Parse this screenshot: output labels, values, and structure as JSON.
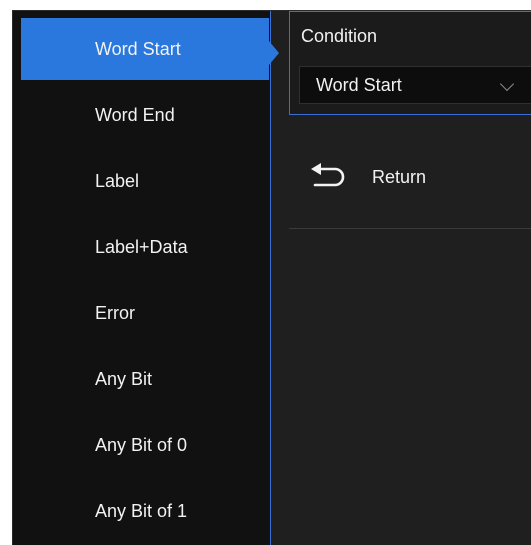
{
  "trigger_condition_list": {
    "items": [
      {
        "label": "Word Start",
        "selected": true
      },
      {
        "label": "Word End",
        "selected": false
      },
      {
        "label": "Label",
        "selected": false
      },
      {
        "label": "Label+Data",
        "selected": false
      },
      {
        "label": "Error",
        "selected": false
      },
      {
        "label": "Any Bit",
        "selected": false
      },
      {
        "label": "Any Bit of 0",
        "selected": false
      },
      {
        "label": "Any Bit of 1",
        "selected": false
      }
    ]
  },
  "condition_panel": {
    "label": "Condition",
    "selected_value": "Word Start"
  },
  "return_button": {
    "label": "Return"
  },
  "colors": {
    "accent": "#2a77de",
    "list_background": "#111111",
    "panel_background": "#1f1f1f",
    "text": "#f2f2f2"
  },
  "icons": {
    "dropdown": "chevron-down-icon",
    "return": "return-arrow-icon"
  }
}
